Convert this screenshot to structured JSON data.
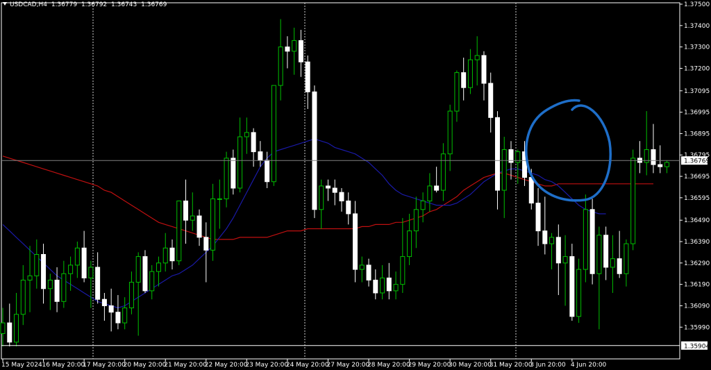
{
  "header": {
    "symbol": "USDCAD,H4",
    "open": "1.36779",
    "high": "1.36792",
    "low": "1.36743",
    "close": "1.36769"
  },
  "colors": {
    "background": "#000000",
    "grid_frame": "#ffffff",
    "bull_candle_body": "#000000",
    "bull_candle_border": "#00c000",
    "bear_candle_body": "#ffffff",
    "bear_candle_border": "#ffffff",
    "ma_fast": "#1a1aa8",
    "ma_slow": "#c01010",
    "price_line": "#808080",
    "annotation_circle": "#1e6ec8"
  },
  "chart_data": {
    "type": "candlestick",
    "symbol": "USDCAD",
    "timeframe": "H4",
    "price_axis_ticks": [
      "1.37500",
      "1.37400",
      "1.37300",
      "1.37200",
      "1.37095",
      "1.36995",
      "1.36895",
      "1.36795",
      "1.36695",
      "1.36595",
      "1.36490",
      "1.36390",
      "1.36290",
      "1.36190",
      "1.36090",
      "1.35990"
    ],
    "ylim": [
      1.3588,
      1.3751
    ],
    "time_axis_labels": [
      "15 May 2024",
      "16 May 20:00",
      "17 May 20:00",
      "20 May 20:00",
      "21 May 20:00",
      "22 May 20:00",
      "23 May 20:00",
      "24 May 20:00",
      "27 May 20:00",
      "28 May 20:00",
      "29 May 20:00",
      "30 May 20:00",
      "31 May 20:00",
      "3 Jun 20:00",
      "4 Jun 20:00"
    ],
    "current_price_label": "1.36769",
    "current_price": 1.36769,
    "horizontal_line_label": "1.35904",
    "horizontal_line": 1.35904,
    "candles": [
      {
        "o": 1.3596,
        "h": 1.3608,
        "l": 1.359,
        "c": 1.3601
      },
      {
        "o": 1.3601,
        "h": 1.361,
        "l": 1.359,
        "c": 1.3592
      },
      {
        "o": 1.3592,
        "h": 1.3615,
        "l": 1.359,
        "c": 1.3605
      },
      {
        "o": 1.3605,
        "h": 1.3628,
        "l": 1.36,
        "c": 1.3621
      },
      {
        "o": 1.3621,
        "h": 1.3637,
        "l": 1.3606,
        "c": 1.3623
      },
      {
        "o": 1.3623,
        "h": 1.364,
        "l": 1.3617,
        "c": 1.3633
      },
      {
        "o": 1.3633,
        "h": 1.3638,
        "l": 1.361,
        "c": 1.3617
      },
      {
        "o": 1.3617,
        "h": 1.3624,
        "l": 1.3607,
        "c": 1.3621
      },
      {
        "o": 1.3621,
        "h": 1.3627,
        "l": 1.3606,
        "c": 1.3611
      },
      {
        "o": 1.3611,
        "h": 1.363,
        "l": 1.3608,
        "c": 1.3624
      },
      {
        "o": 1.3624,
        "h": 1.3632,
        "l": 1.3616,
        "c": 1.3628
      },
      {
        "o": 1.3628,
        "h": 1.3639,
        "l": 1.3622,
        "c": 1.3636
      },
      {
        "o": 1.3636,
        "h": 1.3644,
        "l": 1.362,
        "c": 1.3622
      },
      {
        "o": 1.3622,
        "h": 1.363,
        "l": 1.3608,
        "c": 1.3627
      },
      {
        "o": 1.3627,
        "h": 1.3634,
        "l": 1.361,
        "c": 1.3612
      },
      {
        "o": 1.3612,
        "h": 1.3615,
        "l": 1.3602,
        "c": 1.3609
      },
      {
        "o": 1.3609,
        "h": 1.3617,
        "l": 1.3597,
        "c": 1.3606
      },
      {
        "o": 1.3606,
        "h": 1.3614,
        "l": 1.3598,
        "c": 1.3601
      },
      {
        "o": 1.3601,
        "h": 1.3613,
        "l": 1.3598,
        "c": 1.3608
      },
      {
        "o": 1.3608,
        "h": 1.3625,
        "l": 1.3605,
        "c": 1.362
      },
      {
        "o": 1.362,
        "h": 1.3634,
        "l": 1.3595,
        "c": 1.3632
      },
      {
        "o": 1.3632,
        "h": 1.3635,
        "l": 1.3615,
        "c": 1.3616
      },
      {
        "o": 1.3616,
        "h": 1.3628,
        "l": 1.3612,
        "c": 1.3625
      },
      {
        "o": 1.3625,
        "h": 1.3632,
        "l": 1.3618,
        "c": 1.3629
      },
      {
        "o": 1.3629,
        "h": 1.3643,
        "l": 1.3625,
        "c": 1.3636
      },
      {
        "o": 1.3636,
        "h": 1.364,
        "l": 1.3626,
        "c": 1.363
      },
      {
        "o": 1.363,
        "h": 1.3648,
        "l": 1.3628,
        "c": 1.3658
      },
      {
        "o": 1.3658,
        "h": 1.3668,
        "l": 1.3638,
        "c": 1.3649
      },
      {
        "o": 1.3649,
        "h": 1.3662,
        "l": 1.3644,
        "c": 1.3651
      },
      {
        "o": 1.3651,
        "h": 1.3654,
        "l": 1.3637,
        "c": 1.3641
      },
      {
        "o": 1.3641,
        "h": 1.3648,
        "l": 1.362,
        "c": 1.3635
      },
      {
        "o": 1.3635,
        "h": 1.3666,
        "l": 1.363,
        "c": 1.3659
      },
      {
        "o": 1.3659,
        "h": 1.3668,
        "l": 1.3645,
        "c": 1.3659
      },
      {
        "o": 1.3659,
        "h": 1.3681,
        "l": 1.3655,
        "c": 1.3678
      },
      {
        "o": 1.3678,
        "h": 1.3682,
        "l": 1.3661,
        "c": 1.3664
      },
      {
        "o": 1.3664,
        "h": 1.3697,
        "l": 1.3662,
        "c": 1.3688
      },
      {
        "o": 1.3688,
        "h": 1.3697,
        "l": 1.368,
        "c": 1.369
      },
      {
        "o": 1.369,
        "h": 1.3692,
        "l": 1.3674,
        "c": 1.3681
      },
      {
        "o": 1.3681,
        "h": 1.3686,
        "l": 1.3674,
        "c": 1.3677
      },
      {
        "o": 1.3677,
        "h": 1.3681,
        "l": 1.3664,
        "c": 1.3667
      },
      {
        "o": 1.3667,
        "h": 1.3712,
        "l": 1.3665,
        "c": 1.3712
      },
      {
        "o": 1.3712,
        "h": 1.3743,
        "l": 1.3705,
        "c": 1.373
      },
      {
        "o": 1.373,
        "h": 1.3735,
        "l": 1.372,
        "c": 1.3728
      },
      {
        "o": 1.3728,
        "h": 1.3739,
        "l": 1.3717,
        "c": 1.3733
      },
      {
        "o": 1.3733,
        "h": 1.3738,
        "l": 1.3716,
        "c": 1.3723
      },
      {
        "o": 1.3723,
        "h": 1.3726,
        "l": 1.3701,
        "c": 1.3709
      },
      {
        "o": 1.3709,
        "h": 1.3712,
        "l": 1.365,
        "c": 1.3654
      },
      {
        "o": 1.3654,
        "h": 1.3668,
        "l": 1.3645,
        "c": 1.3665
      },
      {
        "o": 1.3665,
        "h": 1.3668,
        "l": 1.3658,
        "c": 1.3664
      },
      {
        "o": 1.3664,
        "h": 1.3668,
        "l": 1.3656,
        "c": 1.3662
      },
      {
        "o": 1.3662,
        "h": 1.3664,
        "l": 1.3653,
        "c": 1.3658
      },
      {
        "o": 1.3658,
        "h": 1.3662,
        "l": 1.3647,
        "c": 1.3652
      },
      {
        "o": 1.3652,
        "h": 1.3658,
        "l": 1.362,
        "c": 1.3626
      },
      {
        "o": 1.3626,
        "h": 1.3632,
        "l": 1.362,
        "c": 1.3628
      },
      {
        "o": 1.3628,
        "h": 1.3631,
        "l": 1.3618,
        "c": 1.3621
      },
      {
        "o": 1.3621,
        "h": 1.3626,
        "l": 1.3612,
        "c": 1.3615
      },
      {
        "o": 1.3615,
        "h": 1.3628,
        "l": 1.3612,
        "c": 1.3622
      },
      {
        "o": 1.3622,
        "h": 1.3629,
        "l": 1.3612,
        "c": 1.3616
      },
      {
        "o": 1.3616,
        "h": 1.3625,
        "l": 1.3612,
        "c": 1.3619
      },
      {
        "o": 1.3619,
        "h": 1.365,
        "l": 1.3615,
        "c": 1.3632
      },
      {
        "o": 1.3632,
        "h": 1.3652,
        "l": 1.3628,
        "c": 1.3644
      },
      {
        "o": 1.3644,
        "h": 1.366,
        "l": 1.3636,
        "c": 1.3654
      },
      {
        "o": 1.3654,
        "h": 1.3662,
        "l": 1.3648,
        "c": 1.3658
      },
      {
        "o": 1.3658,
        "h": 1.3671,
        "l": 1.3653,
        "c": 1.3665
      },
      {
        "o": 1.3665,
        "h": 1.3674,
        "l": 1.3662,
        "c": 1.3663
      },
      {
        "o": 1.3663,
        "h": 1.3685,
        "l": 1.3658,
        "c": 1.368
      },
      {
        "o": 1.368,
        "h": 1.3703,
        "l": 1.3672,
        "c": 1.37
      },
      {
        "o": 1.37,
        "h": 1.3719,
        "l": 1.3695,
        "c": 1.3718
      },
      {
        "o": 1.3718,
        "h": 1.3725,
        "l": 1.3705,
        "c": 1.3711
      },
      {
        "o": 1.3711,
        "h": 1.3729,
        "l": 1.3708,
        "c": 1.3724
      },
      {
        "o": 1.3724,
        "h": 1.3735,
        "l": 1.3712,
        "c": 1.3726
      },
      {
        "o": 1.3726,
        "h": 1.3728,
        "l": 1.3705,
        "c": 1.3713
      },
      {
        "o": 1.3713,
        "h": 1.3718,
        "l": 1.369,
        "c": 1.3697
      },
      {
        "o": 1.3697,
        "h": 1.37,
        "l": 1.3654,
        "c": 1.3663
      },
      {
        "o": 1.3663,
        "h": 1.3688,
        "l": 1.365,
        "c": 1.3682
      },
      {
        "o": 1.3682,
        "h": 1.3686,
        "l": 1.3668,
        "c": 1.3676
      },
      {
        "o": 1.3676,
        "h": 1.3682,
        "l": 1.3666,
        "c": 1.3681
      },
      {
        "o": 1.3681,
        "h": 1.3686,
        "l": 1.3665,
        "c": 1.3669
      },
      {
        "o": 1.3669,
        "h": 1.3673,
        "l": 1.3654,
        "c": 1.3657
      },
      {
        "o": 1.3657,
        "h": 1.3664,
        "l": 1.3637,
        "c": 1.3644
      },
      {
        "o": 1.3644,
        "h": 1.366,
        "l": 1.3633,
        "c": 1.3638
      },
      {
        "o": 1.3638,
        "h": 1.3643,
        "l": 1.3626,
        "c": 1.3641
      },
      {
        "o": 1.3641,
        "h": 1.3647,
        "l": 1.3614,
        "c": 1.3629
      },
      {
        "o": 1.3629,
        "h": 1.3642,
        "l": 1.3609,
        "c": 1.3632
      },
      {
        "o": 1.3632,
        "h": 1.3638,
        "l": 1.3602,
        "c": 1.3604
      },
      {
        "o": 1.3604,
        "h": 1.3631,
        "l": 1.3601,
        "c": 1.3626
      },
      {
        "o": 1.3626,
        "h": 1.3661,
        "l": 1.362,
        "c": 1.3654
      },
      {
        "o": 1.3654,
        "h": 1.3659,
        "l": 1.3619,
        "c": 1.3624
      },
      {
        "o": 1.3624,
        "h": 1.3646,
        "l": 1.3598,
        "c": 1.3642
      },
      {
        "o": 1.3642,
        "h": 1.3646,
        "l": 1.3621,
        "c": 1.3627
      },
      {
        "o": 1.3627,
        "h": 1.3642,
        "l": 1.3615,
        "c": 1.3631
      },
      {
        "o": 1.3631,
        "h": 1.3644,
        "l": 1.3622,
        "c": 1.3624
      },
      {
        "o": 1.3624,
        "h": 1.364,
        "l": 1.3618,
        "c": 1.3638
      },
      {
        "o": 1.3638,
        "h": 1.3682,
        "l": 1.3635,
        "c": 1.3678
      },
      {
        "o": 1.3678,
        "h": 1.3686,
        "l": 1.3671,
        "c": 1.3676
      },
      {
        "o": 1.3676,
        "h": 1.37,
        "l": 1.367,
        "c": 1.3682
      },
      {
        "o": 1.3682,
        "h": 1.3694,
        "l": 1.3671,
        "c": 1.3675
      },
      {
        "o": 1.3675,
        "h": 1.3684,
        "l": 1.3671,
        "c": 1.3674
      },
      {
        "o": 1.3674,
        "h": 1.3677,
        "l": 1.3671,
        "c": 1.3676
      }
    ],
    "ma_fast": [
      1.3647,
      1.3644,
      1.3641,
      1.3638,
      1.3635,
      1.3632,
      1.3629,
      1.3626,
      1.3623,
      1.3621,
      1.3619,
      1.3617,
      1.3615,
      1.3613,
      1.3611,
      1.361,
      1.3609,
      1.3608,
      1.3609,
      1.3611,
      1.3613,
      1.3615,
      1.3617,
      1.3619,
      1.3621,
      1.3623,
      1.3624,
      1.3626,
      1.3628,
      1.3631,
      1.3634,
      1.3637,
      1.3641,
      1.3645,
      1.365,
      1.3656,
      1.3662,
      1.3668,
      1.3674,
      1.3678,
      1.3681,
      1.3682,
      1.3683,
      1.3684,
      1.3685,
      1.3686,
      1.3687,
      1.3686,
      1.3685,
      1.3683,
      1.3682,
      1.3681,
      1.368,
      1.3678,
      1.3676,
      1.3673,
      1.367,
      1.3666,
      1.3663,
      1.3661,
      1.366,
      1.3659,
      1.3658,
      1.3657,
      1.3656,
      1.3656,
      1.3656,
      1.3657,
      1.3659,
      1.3661,
      1.3664,
      1.3667,
      1.3669,
      1.3671,
      1.3672,
      1.3673,
      1.3673,
      1.3672,
      1.3671,
      1.367,
      1.3668,
      1.3667,
      1.3665,
      1.3662,
      1.3659,
      1.3656,
      1.3654,
      1.3653,
      1.3652,
      1.3652
    ],
    "ma_slow": [
      1.3679,
      1.3678,
      1.3677,
      1.3676,
      1.3675,
      1.3674,
      1.3673,
      1.3672,
      1.3671,
      1.367,
      1.3669,
      1.3668,
      1.3667,
      1.3666,
      1.3665,
      1.3663,
      1.3662,
      1.366,
      1.3658,
      1.3656,
      1.3654,
      1.3652,
      1.365,
      1.3648,
      1.3647,
      1.3646,
      1.3645,
      1.3644,
      1.3643,
      1.3642,
      1.3641,
      1.364,
      1.364,
      1.364,
      1.364,
      1.3641,
      1.3641,
      1.3641,
      1.3641,
      1.3641,
      1.3642,
      1.3643,
      1.3644,
      1.3644,
      1.3644,
      1.3645,
      1.3645,
      1.3645,
      1.3645,
      1.3645,
      1.3645,
      1.3645,
      1.3645,
      1.3646,
      1.3646,
      1.3647,
      1.3647,
      1.3647,
      1.3648,
      1.3648,
      1.3649,
      1.365,
      1.3651,
      1.3653,
      1.3654,
      1.3656,
      1.3658,
      1.366,
      1.3663,
      1.3665,
      1.3667,
      1.3669,
      1.367,
      1.3671,
      1.3671,
      1.367,
      1.3669,
      1.3668,
      1.3667,
      1.3666,
      1.3665,
      1.3665,
      1.3666,
      1.3666,
      1.3666,
      1.3666,
      1.3666,
      1.3666,
      1.3666,
      1.3666,
      1.3666,
      1.3666,
      1.3666,
      1.3666,
      1.3666,
      1.3666,
      1.3666
    ],
    "ma_fast_range": [
      0,
      89
    ],
    "ma_slow_range": [
      0,
      98
    ]
  }
}
